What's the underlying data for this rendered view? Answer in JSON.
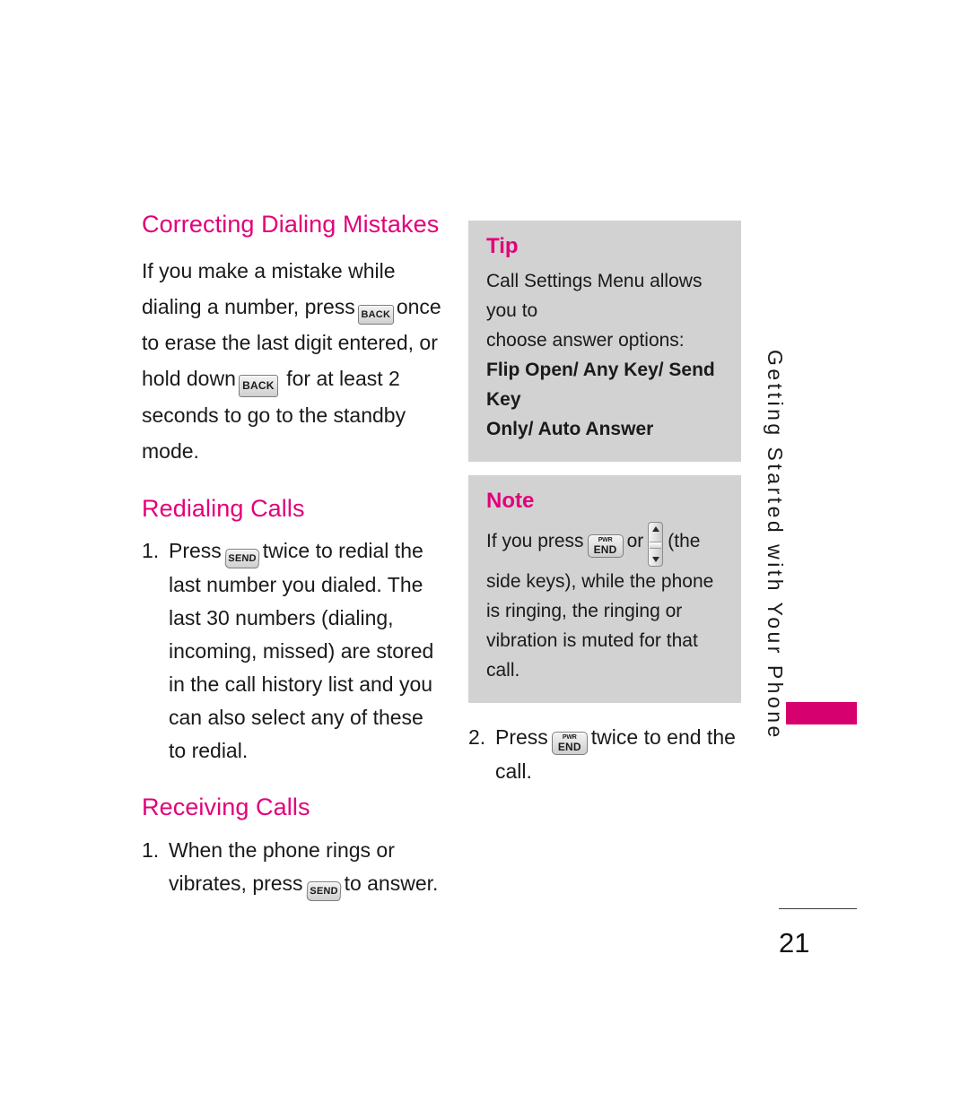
{
  "page": {
    "number": "21",
    "side_tab_label": "Getting Started with Your Phone",
    "side_tab_color": "#d6006e",
    "heading_color": "#e2007a",
    "callout_bg": "#d2d2d2"
  },
  "left_column": {
    "section1": {
      "heading": "Correcting Dialing Mistakes",
      "paragraph_part1": "If you make a mistake while dialing a number, press",
      "key1": "BACK",
      "paragraph_part2": "once to erase the last digit entered, or hold down",
      "key2": "BACK",
      "paragraph_part3": "for at least 2 seconds to go to the standby mode."
    },
    "section2": {
      "heading": "Redialing Calls",
      "step1": {
        "number": "1.",
        "text_part1": "Press",
        "key": "SEND",
        "text_part2": "twice to redial the last number you dialed. The last 30 numbers (dialing, incoming, missed) are stored in the call history list and you can also select any of these to redial."
      }
    },
    "section3": {
      "heading": "Receiving Calls",
      "step1": {
        "number": "1.",
        "text_part1": "When the phone rings or vibrates, press",
        "key": "SEND",
        "text_part2": "to answer."
      }
    }
  },
  "right_column": {
    "tip_box": {
      "title": "Tip",
      "line1": "Call Settings Menu allows you to",
      "line2": "choose answer options:",
      "line3_bold": "Flip Open/ Any Key/ Send Key",
      "line4_bold": "Only/ Auto Answer"
    },
    "note_box": {
      "title": "Note",
      "text_part1": "If you press",
      "key_end_top": "PWR",
      "key_end_bottom": "END",
      "text_part2": "or",
      "text_part3": "(the side keys), while the phone is ringing, the ringing or vibration is muted for that call."
    },
    "step2": {
      "number": "2.",
      "text_part1": "Press",
      "key_end_top": "PWR",
      "key_end_bottom": "END",
      "text_part2": "twice to end the call."
    }
  }
}
